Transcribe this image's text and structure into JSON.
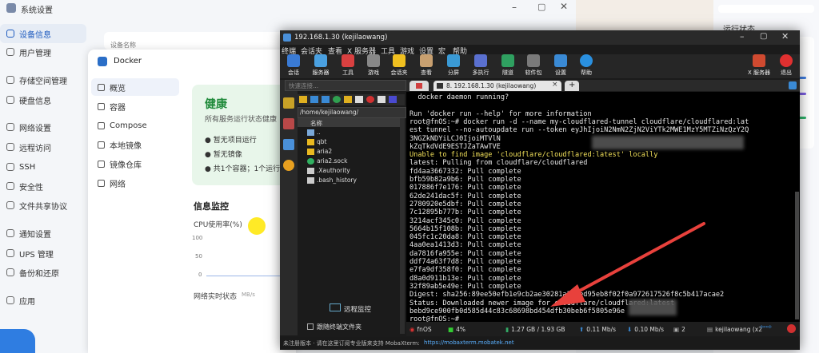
{
  "settings": {
    "title": "系统设置",
    "nav": [
      {
        "label": "设备信息",
        "active": true
      },
      {
        "label": "用户管理"
      },
      {
        "label": "存储空间管理"
      },
      {
        "label": "硬盘信息"
      },
      {
        "label": "网络设置"
      },
      {
        "label": "远程访问"
      },
      {
        "label": "SSH"
      },
      {
        "label": "安全性"
      },
      {
        "label": "文件共享协议"
      },
      {
        "label": "通知设置"
      },
      {
        "label": "UPS 管理"
      },
      {
        "label": "备份和还原"
      },
      {
        "label": "应用"
      }
    ],
    "device_name_label": "设备名称",
    "right_section": "运行状态"
  },
  "docker": {
    "title": "Docker",
    "nav": [
      {
        "label": "概览",
        "active": true
      },
      {
        "label": "容器"
      },
      {
        "label": "Compose"
      },
      {
        "label": "本地镜像"
      },
      {
        "label": "镜像仓库"
      },
      {
        "label": "网络"
      }
    ],
    "health_title": "健康",
    "health_desc": "所有服务运行状态健康",
    "checks": [
      "暂无项目运行",
      "暂无镜像",
      "共1个容器；1个运行"
    ],
    "monitor_title": "信息监控",
    "cpu_label": "CPU使用率(%)",
    "cpu_ticks": [
      "100",
      "50",
      "0"
    ],
    "net_label": "网络实时状态",
    "net_unit": "MB/s"
  },
  "terminal": {
    "title": "192.168.1.30 (kejilaowang)",
    "menu": [
      "终端",
      "会话夹",
      "查看",
      "X 服务器",
      "工具",
      "游戏",
      "设置",
      "宏",
      "帮助"
    ],
    "toolbar": [
      "会话",
      "服务器",
      "工具",
      "游戏",
      "会话夹",
      "查看",
      "分屏",
      "多执行",
      "隧道",
      "软件包",
      "设置",
      "帮助"
    ],
    "toolbar_right": [
      "X 服务器",
      "退出"
    ],
    "quick_connect_placeholder": "快速连接...",
    "tab_label": "8. 192.168.1.30 (kejilaowang)",
    "path": "/home/kejilaowang/",
    "file_header": "名称",
    "files": [
      "..",
      "qbt",
      "aria2",
      "aria2.sock",
      ".Xauthority",
      ".bash_history"
    ],
    "remote_monitor": "远程监控",
    "follow_terminal": "跟随终端文件夹",
    "lines": [
      "  docker daemon running?",
      "",
      "Run 'docker run --help' for more information",
      "root@fnOS:~# docker run -d --name my-cloudflared-tunnel cloudflare/cloudflared:lat",
      "est tunnel --no-autoupdate run --token eyJhIjoiN2NmN2ZjN2ViYTk2MWE1MzY5MTZiNzQzY2Q",
      "3NGZkNDYiLCJ0IjoiMTVlN",
      "kZqTkdVdE9ESTJZaTAwTVE",
      "Unable to find image 'cloudflare/cloudflared:latest' locally",
      "latest: Pulling from cloudflare/cloudflared",
      "fd4aa3667332: Pull complete",
      "bfb59b82a9b6: Pull complete",
      "017886f7e176: Pull complete",
      "62de241dac5f: Pull complete",
      "2780920e5dbf: Pull complete",
      "7c12895b777b: Pull complete",
      "3214acf345c0: Pull complete",
      "5664b15f108b: Pull complete",
      "045fc1c20da8: Pull complete",
      "4aa0ea1413d3: Pull complete",
      "da7816fa955e: Pull complete",
      "ddf74a63f7d8: Pull complete",
      "e7fa9df358f0: Pull complete",
      "d8a0d911b13e: Pull complete",
      "32f89ab5e49e: Pull complete",
      "Digest: sha256:89ee50efb1e9cb2ae30281a24fed95eb8f02f0a972617526f8c5b417acae2",
      "Status: Downloaded newer image for cloudflare/cloudflared:latest",
      "bebd9ce900fb0d585d44c83c68698bd454dfb30beb6f5805e96e",
      "root@fnOS:~# "
    ],
    "status": {
      "host": "fnOS",
      "cpu": "4%",
      "mem": "1.27 GB / 1.93 GB",
      "up": "0.11 Mb/s",
      "down": "0.10 Mb/s",
      "users": "2",
      "user": "kejilaowang (x2"
    },
    "footer_left": "未注册版本 · 请在这里订阅专业版来支持 MobaXterm:",
    "footer_link": "https://mobaxterm.mobatek.net"
  },
  "colors": {
    "accent": "#1e5bbf",
    "health_green": "#e8f6ea",
    "terminal_bg": "#1b1b1b",
    "prompt_cyan": "#5ec4ff",
    "yellow_text": "#f1e05a",
    "arrow_red": "#e8413c"
  }
}
